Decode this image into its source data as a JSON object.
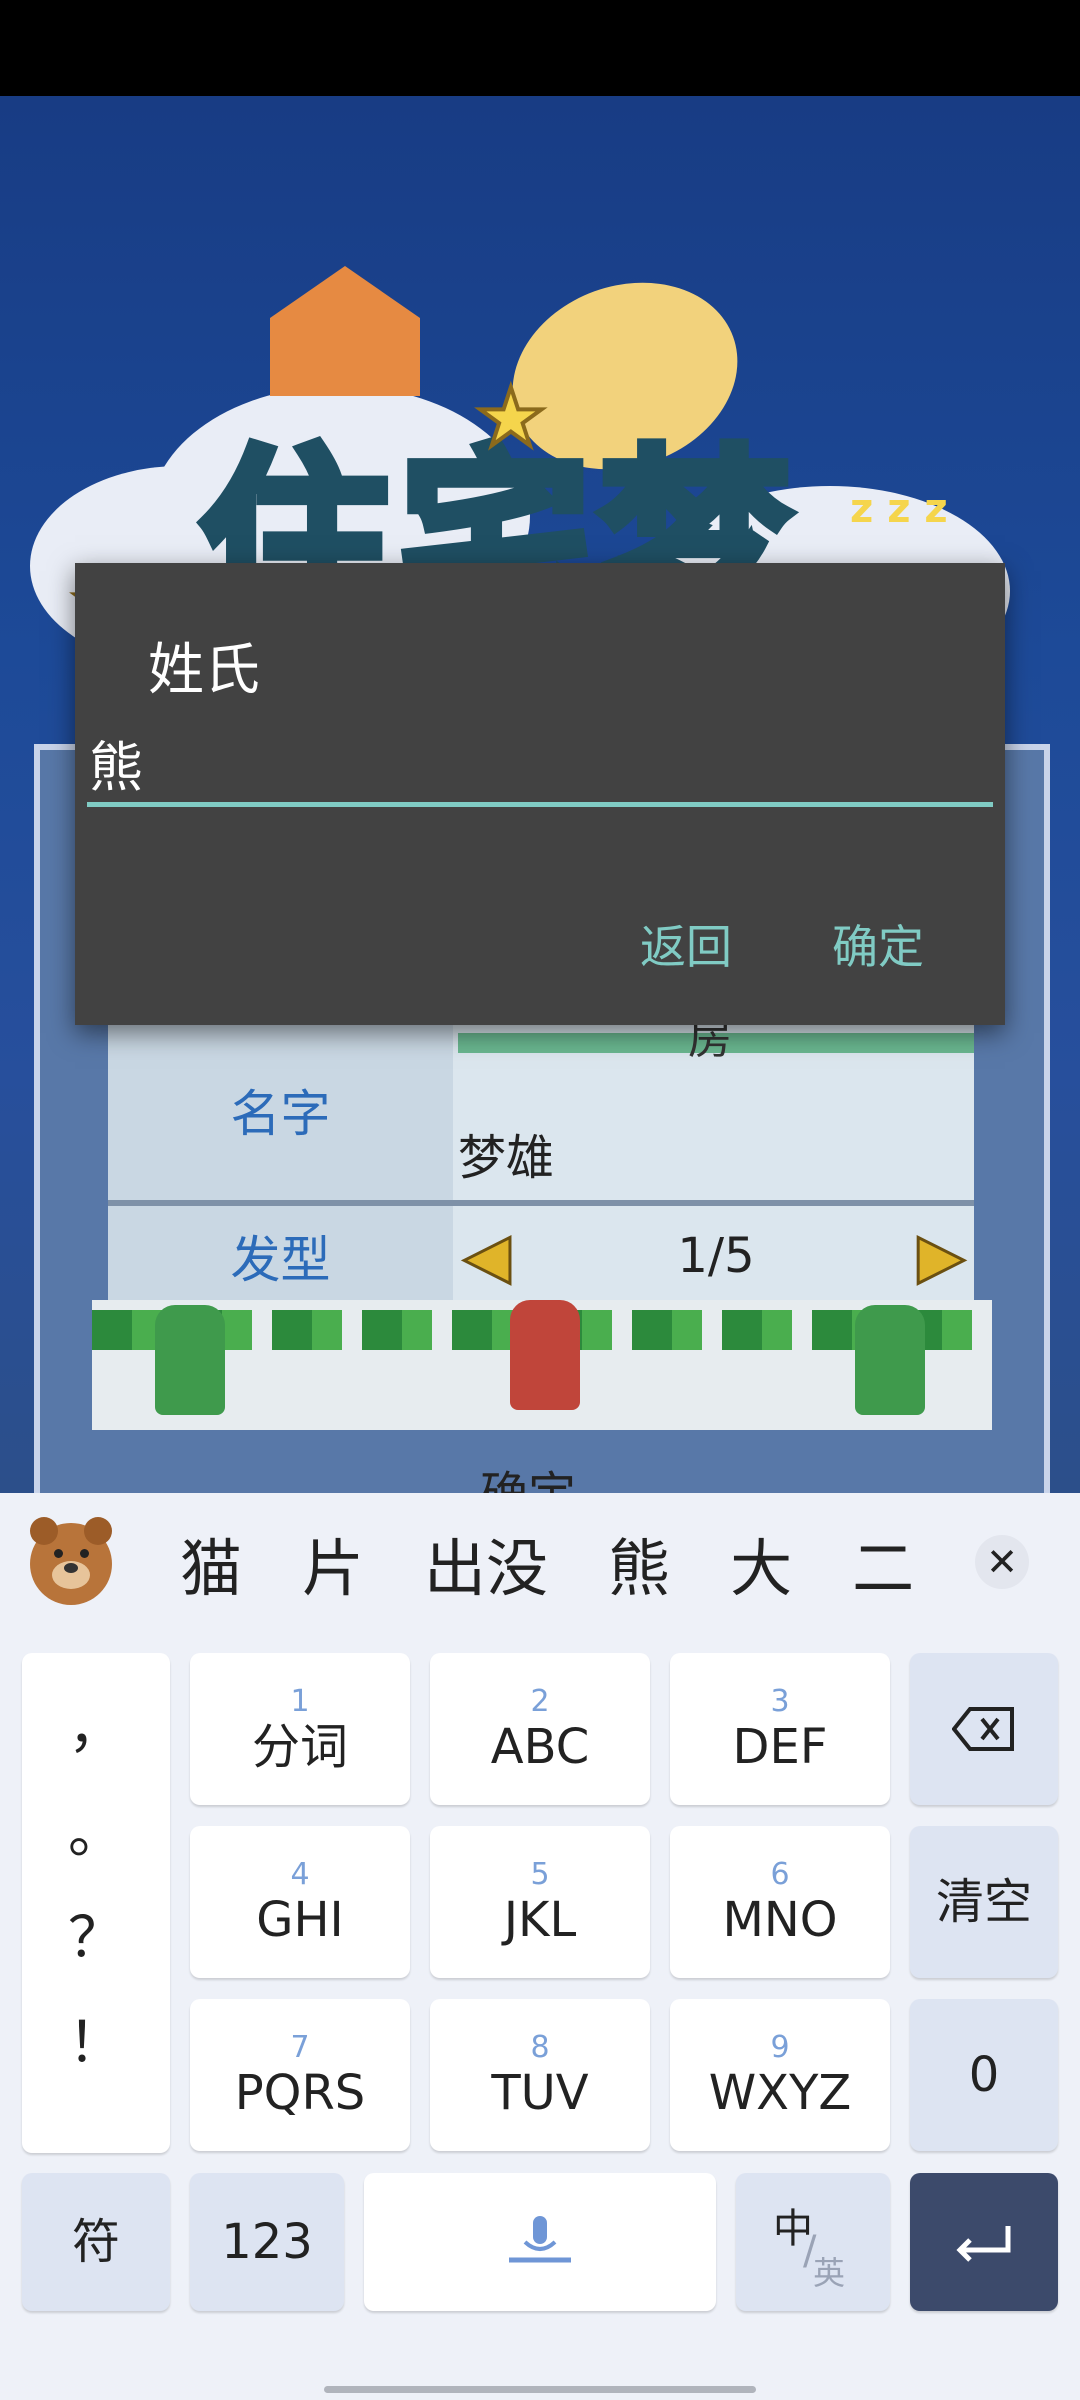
{
  "dialog": {
    "title": "姓氏",
    "input_value": "熊",
    "cancel_label": "返回",
    "ok_label": "确定"
  },
  "game": {
    "logo_text": "住宅梦",
    "rows": [
      {
        "label": "名字",
        "value": "梦雄",
        "partial": "房"
      },
      {
        "label": "发型",
        "value": "1/5"
      }
    ],
    "confirm_label": "确定"
  },
  "keyboard": {
    "candidates": [
      "猫",
      "片",
      "出没",
      "熊",
      "大",
      "二"
    ],
    "emoji_candidate": "bear-emoji",
    "punctuation": [
      "，",
      "。",
      "？",
      "！"
    ],
    "keys": [
      {
        "num": "1",
        "label": "分词"
      },
      {
        "num": "2",
        "label": "ABC"
      },
      {
        "num": "3",
        "label": "DEF"
      },
      {
        "num": "4",
        "label": "GHI"
      },
      {
        "num": "5",
        "label": "JKL"
      },
      {
        "num": "6",
        "label": "MNO"
      },
      {
        "num": "7",
        "label": "PQRS"
      },
      {
        "num": "8",
        "label": "TUV"
      },
      {
        "num": "9",
        "label": "WXYZ"
      }
    ],
    "clear_label": "清空",
    "zero_label": "0",
    "symbol_label": "符",
    "numeric_label": "123",
    "lang_main": "中",
    "lang_alt": "英"
  },
  "colors": {
    "accent": "#80cbc4",
    "dialog_bg": "#424242",
    "keyboard_bg": "#eef1f8",
    "enter_key": "#3c4a6b"
  }
}
